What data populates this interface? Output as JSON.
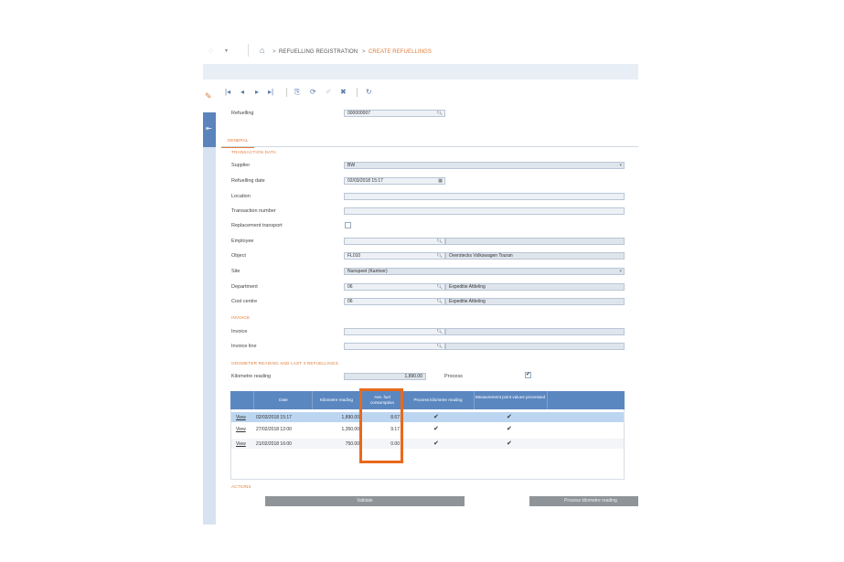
{
  "breadcrumb": {
    "items": [
      "REFUELLING REGISTRATION",
      "CREATE REFUELLINGS"
    ],
    "separator": ">"
  },
  "toolbar": {
    "icons": [
      "first-record-icon",
      "previous-record-icon",
      "next-record-icon",
      "last-record-icon",
      "copy-icon",
      "refresh-icon",
      "edit-icon",
      "delete-icon",
      "reload-icon"
    ]
  },
  "header": {
    "refuelling_label": "Refuelling",
    "refuelling_value": "000000007"
  },
  "tabs": [
    {
      "label": "GENERAL"
    }
  ],
  "transaction": {
    "section_title": "TRANSACTION DATA",
    "supplier_label": "Supplier",
    "supplier_value": "BW",
    "refuelling_date_label": "Refuelling date",
    "refuelling_date_value": "02/03/2018 15:17",
    "location_label": "Location",
    "transaction_number_label": "Transaction number",
    "replacement_transport_label": "Replacement transport",
    "employee_label": "Employee",
    "object_label": "Object",
    "object_code": "FL010",
    "object_description": "Overstecks Volkswagen Touran",
    "site_label": "Site",
    "site_value": "Nunspeet (Kantoor)",
    "department_label": "Department",
    "department_code": "06",
    "department_description": "Expeditie Afdeling",
    "cost_centre_label": "Cost centre",
    "cost_centre_code": "06",
    "cost_centre_description": "Expeditie Afdeling"
  },
  "invoice": {
    "section_title": "INVOICE",
    "invoice_label": "Invoice",
    "invoice_line_label": "Invoice line"
  },
  "odometer": {
    "section_title": "ODOMETER READING AND LAST 3 REFUELLINGS",
    "kilometre_reading_label": "Kilometre reading",
    "kilometre_reading_value": "1,890.00",
    "process_label": "Process",
    "process_checked": true
  },
  "grid": {
    "headers": [
      "Date",
      "Kilometre reading",
      "Ave. fuel consumption",
      "Process kilometre reading",
      "Measurement point values processed"
    ],
    "rows": [
      {
        "link": "View",
        "date": "02/03/2018 15:17",
        "km": "1,890.00",
        "fuel": "8.67",
        "process": true,
        "measured": true,
        "selected": true
      },
      {
        "link": "View",
        "date": "27/02/2018 12:00",
        "km": "1,350.00",
        "fuel": "9.17",
        "process": true,
        "measured": true,
        "selected": false
      },
      {
        "link": "View",
        "date": "21/02/2018 16:00",
        "km": "750.00",
        "fuel": "0.00",
        "process": true,
        "measured": true,
        "selected": false
      }
    ]
  },
  "actions": {
    "section_title": "ACTIONS",
    "validate_label": "Validate",
    "process_km_label": "Process kilometre reading"
  },
  "colors": {
    "accent": "#e07b39",
    "grid_header": "#5b87c0",
    "selected_row": "#bcd6f1",
    "highlight": "#e8691c"
  }
}
